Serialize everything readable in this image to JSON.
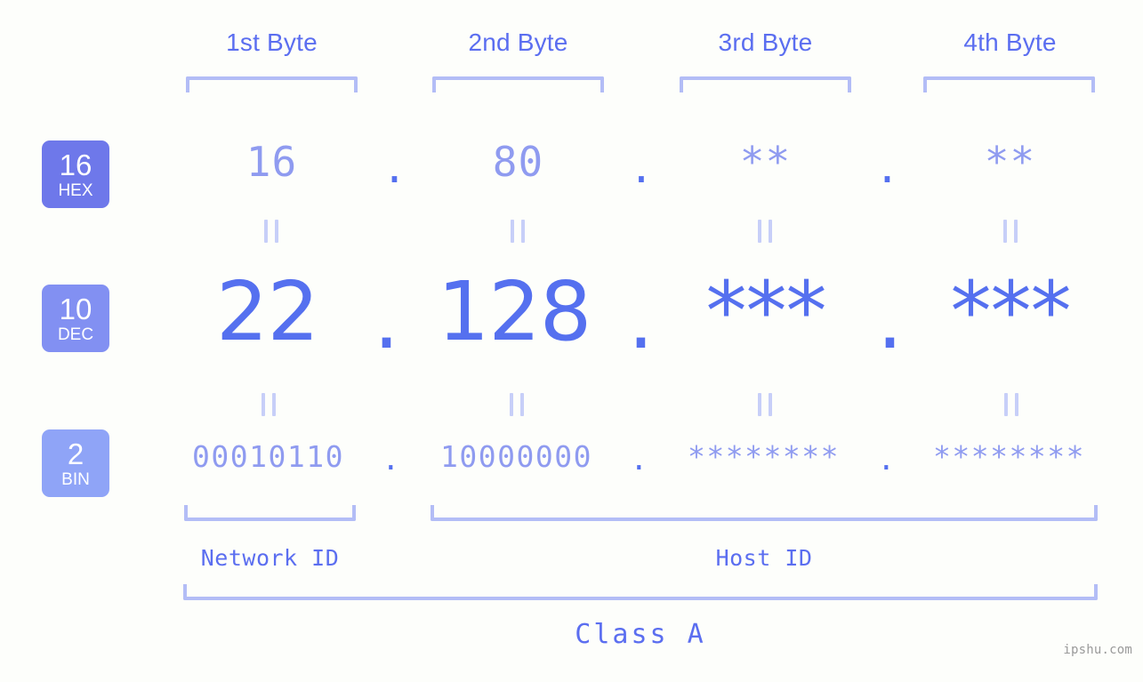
{
  "background_color": "#fdfefb",
  "accent_color": "#5570ef",
  "bracket_color": "#b3bdf6",
  "headers": {
    "byte1": "1st Byte",
    "byte2": "2nd Byte",
    "byte3": "3rd Byte",
    "byte4": "4th Byte"
  },
  "badges": {
    "hex": {
      "base": "16",
      "abbr": "HEX",
      "color": "#6e78ea"
    },
    "dec": {
      "base": "10",
      "abbr": "DEC",
      "color": "#8290f2"
    },
    "bin": {
      "base": "2",
      "abbr": "BIN",
      "color": "#8fa4f7"
    }
  },
  "separator": ".",
  "equals_mark": "||",
  "rows": {
    "hex": {
      "label": "HEX",
      "byte1": "16",
      "byte2": "80",
      "byte3": "**",
      "byte4": "**"
    },
    "dec": {
      "label": "DEC",
      "byte1": "22",
      "byte2": "128",
      "byte3": "***",
      "byte4": "***"
    },
    "bin": {
      "label": "BIN",
      "byte1": "00010110",
      "byte2": "10000000",
      "byte3": "********",
      "byte4": "********"
    }
  },
  "footer": {
    "network_id": "Network ID",
    "host_id": "Host ID",
    "class": "Class A"
  },
  "watermark": "ipshu.com"
}
